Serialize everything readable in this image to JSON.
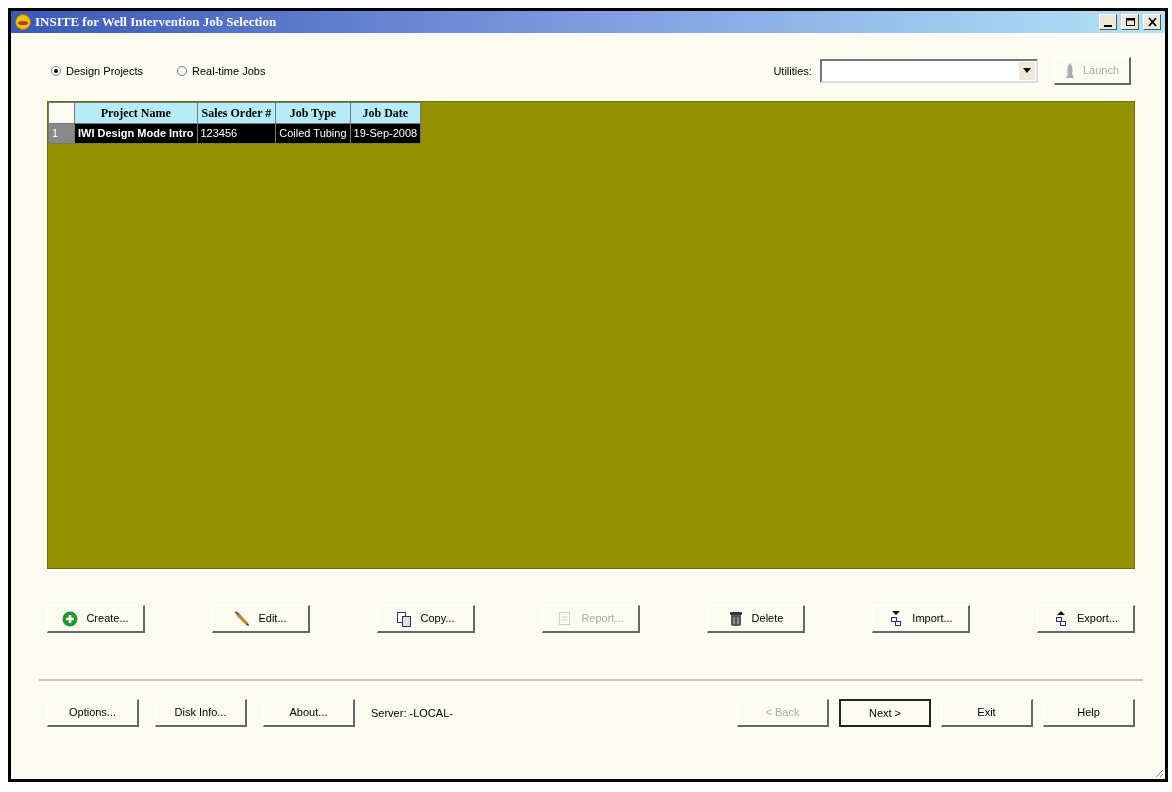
{
  "window": {
    "title": "INSITE for Well Intervention Job Selection"
  },
  "mode_options": [
    {
      "label": "Design Projects",
      "selected": true
    },
    {
      "label": "Real-time Jobs",
      "selected": false
    }
  ],
  "utilities": {
    "label": "Utilities:"
  },
  "launch_button": {
    "label": "Launch",
    "disabled": true
  },
  "table": {
    "columns": [
      "Project Name",
      "Sales Order #",
      "Job Type",
      "Job Date"
    ],
    "rows": [
      {
        "number": "1",
        "selected": true,
        "cells": [
          "IWI Design Mode Intro",
          "123456",
          "Coiled Tubing",
          "19-Sep-2008"
        ]
      }
    ]
  },
  "action_buttons": [
    {
      "label": "Create...",
      "disabled": false
    },
    {
      "label": "Edit...",
      "disabled": false
    },
    {
      "label": "Copy...",
      "disabled": false
    },
    {
      "label": "Report...",
      "disabled": true
    },
    {
      "label": "Delete",
      "disabled": false
    },
    {
      "label": "Import...",
      "disabled": false
    },
    {
      "label": "Export...",
      "disabled": false
    }
  ],
  "footer_buttons": [
    {
      "label": "Options...",
      "disabled": false
    },
    {
      "label": "Disk Info...",
      "disabled": false
    },
    {
      "label": "About...",
      "disabled": false
    }
  ],
  "server": "Server: -LOCAL-",
  "nav_buttons": [
    {
      "label": "< Back",
      "disabled": true,
      "default": false
    },
    {
      "label": "Next >",
      "disabled": false,
      "default": true
    },
    {
      "label": "Exit",
      "disabled": false,
      "default": false
    },
    {
      "label": "Help",
      "disabled": false,
      "default": false
    }
  ]
}
